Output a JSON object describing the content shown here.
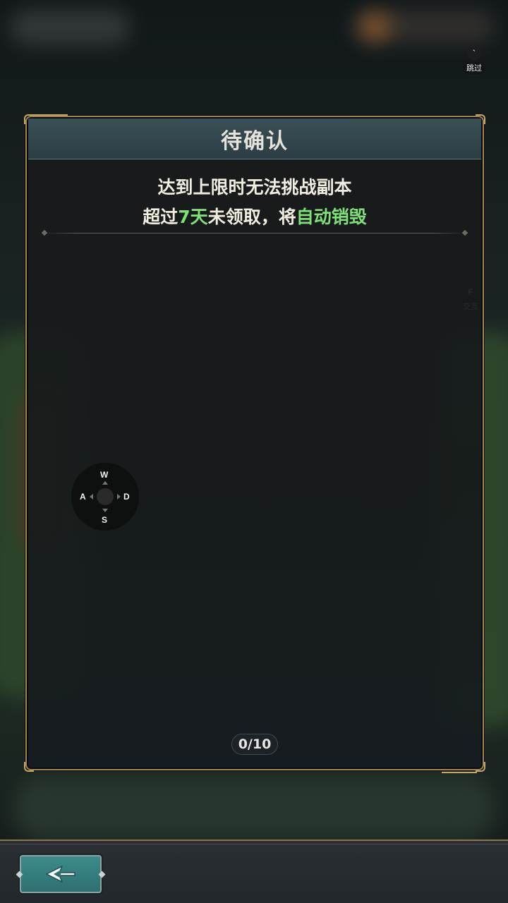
{
  "hud": {
    "skip": {
      "key": "`",
      "label": "跳过"
    },
    "interact": {
      "key": "F",
      "label": "交互"
    },
    "joystick": {
      "up": "W",
      "down": "S",
      "left": "A",
      "right": "D"
    }
  },
  "dialog": {
    "title": "待确认",
    "line1": "达到上限时无法挑战副本",
    "line2_prefix": "超过",
    "line2_days": "7天",
    "line2_mid": "未领取，将",
    "line2_action": "自动销毁",
    "counter": "0/10"
  },
  "colors": {
    "highlight": "#7fe07a",
    "frame": "#a38452",
    "header": "#34484f",
    "back_button": "#3c8b8a"
  },
  "icons": {
    "back": "back-arrow-icon"
  }
}
